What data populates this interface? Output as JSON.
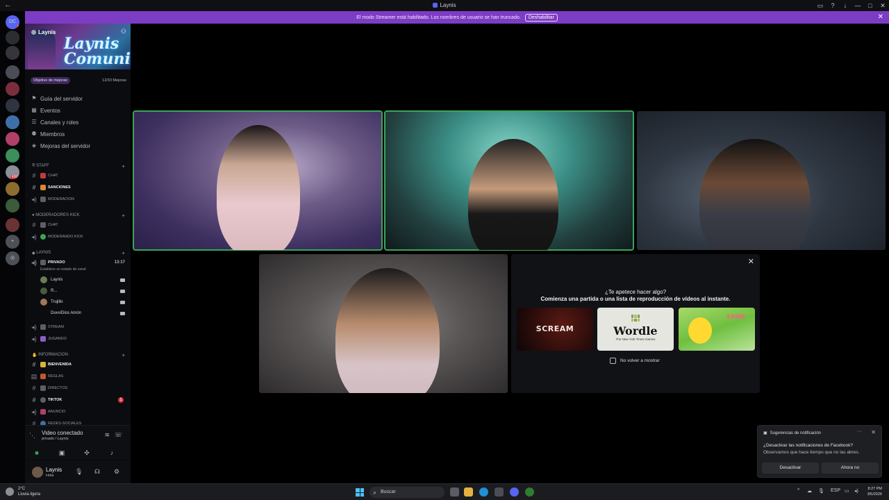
{
  "window": {
    "title": "Laynis"
  },
  "banner": {
    "message": "El modo Streamer está habilitado. Los nombres de usuario se han truncado.",
    "disable_label": "Deshabilitar"
  },
  "rail": {
    "servers": [
      {
        "label": "DC",
        "badge": "8"
      },
      {
        "label": "",
        "badge": ""
      },
      {
        "label": "",
        "badge": ""
      },
      {
        "label": "",
        "badge": ""
      },
      {
        "label": "",
        "badge": ""
      },
      {
        "label": "",
        "badge": ""
      },
      {
        "label": "",
        "badge": ""
      },
      {
        "label": "",
        "badge": ""
      },
      {
        "label": "",
        "badge": ""
      },
      {
        "label": "",
        "badge": ""
      },
      {
        "label": "",
        "badge": "4368"
      },
      {
        "label": "",
        "badge": ""
      },
      {
        "label": "",
        "badge": ""
      },
      {
        "label": "",
        "badge": ""
      },
      {
        "label": "",
        "badge": ""
      }
    ]
  },
  "server": {
    "name": "Laynis",
    "banner_art_text": "Laynis Comunity",
    "boost_goal": "Objetivo de mejoras",
    "boost_progress": "12/33 Mejoras",
    "menu": [
      {
        "label": "Guía del servidor",
        "icon": "signpost-icon"
      },
      {
        "label": "Eventos",
        "icon": "calendar-icon"
      },
      {
        "label": "Canales y roles",
        "icon": "channels-icon"
      },
      {
        "label": "Miembros",
        "icon": "members-icon"
      },
      {
        "label": "Mejoras del servidor",
        "icon": "boost-icon"
      }
    ],
    "categories": {
      "staff": "STAFF",
      "mods": "MODERADORES KICK",
      "laynis": "LAYNIS",
      "info": "INFORMACION"
    },
    "channels": {
      "staff": [
        "CHAT",
        "SANCIONES",
        "MODERACION"
      ],
      "mods": [
        "CHAT",
        "MODERANDO KICK"
      ],
      "laynis": [
        "PRIVADO",
        "STREAM",
        "JUGANDO"
      ],
      "info": [
        "BIENVENIDA",
        "REGLAS",
        "DIRECTOS",
        "TIKTOK",
        "ANUNCIO",
        "REDES-SOCIALES"
      ]
    },
    "voice_timer": "13:17",
    "voice_status": "Establece un estado de canal",
    "voice_users": [
      "Laynis",
      "R...",
      "Trujillo",
      "DuvviDios   Amón"
    ],
    "tiktok_unread": "1"
  },
  "voice_panel": {
    "title": "Video conectado",
    "subtitle": "privado / Laynis"
  },
  "user": {
    "name": "Laynis",
    "status": "Hola"
  },
  "activity": {
    "title": "¿Te apetece hacer algo?",
    "subtitle": "Comienza una partida o una lista de reproducción de vídeos al instante.",
    "games": [
      {
        "label": "SCREAM"
      },
      {
        "label": "Wordle",
        "sub": "The New York Times Games"
      },
      {
        "label": "FARM"
      }
    ],
    "dont_show_label": "No volver a mostrar"
  },
  "toast": {
    "header": "Sugerencias de notificación",
    "line1": "¿Desactivar las notificaciones de Facebook?",
    "line2": "Observamos que hace tiempo que no las abres.",
    "primary_label": "Desactivar",
    "secondary_label": "Ahora no"
  },
  "taskbar": {
    "weather_temp": "2°C",
    "weather_desc": "Lluvia ligera",
    "search_placeholder": "Buscar",
    "lang": "ESP",
    "time": "8:27 PM",
    "date": "3/5/2026"
  },
  "colors": {
    "banner": "#7d3cc4",
    "speaking_outline": "#3ba55c",
    "sidebar_bg": "#0b0c10",
    "unread_badge": "#da373c"
  }
}
